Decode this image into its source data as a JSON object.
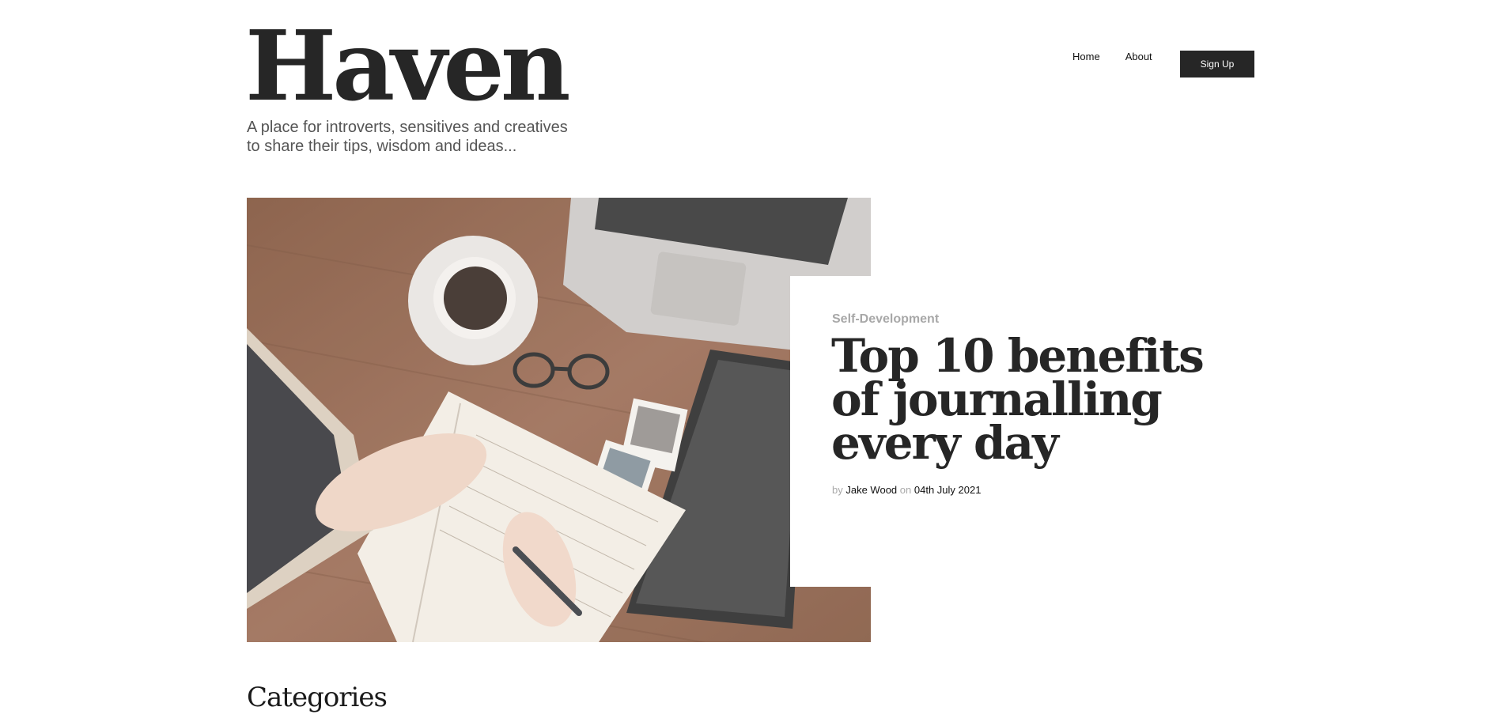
{
  "site": {
    "logo": "Haven",
    "tagline": "A place for introverts, sensitives and creatives to share their tips, wisdom and ideas..."
  },
  "nav": {
    "home": "Home",
    "about": "About",
    "signup": "Sign Up"
  },
  "featured": {
    "category": "Self-Development",
    "title": "Top 10 benefits of journalling every day",
    "by_label": "by",
    "author": "Jake Wood",
    "on_label": "on",
    "date": "04th July 2021"
  },
  "sections": {
    "categories_heading": "Categories"
  },
  "colors": {
    "dark": "#262626",
    "muted": "#a8a8a8"
  }
}
